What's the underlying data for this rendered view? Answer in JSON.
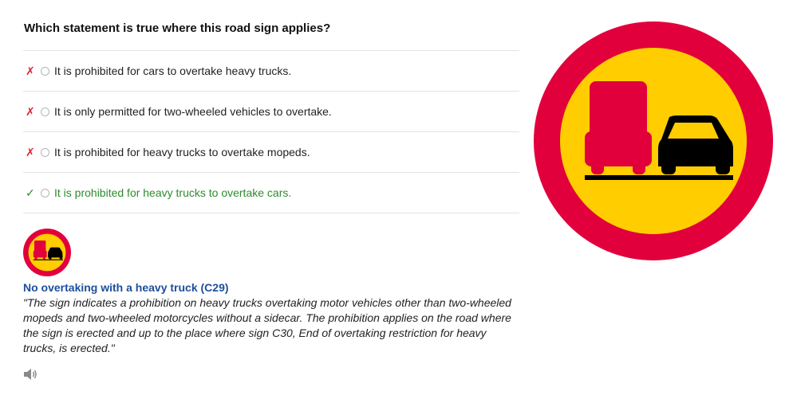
{
  "question": "Which statement is true where this road sign applies?",
  "answers": [
    {
      "mark": "✗",
      "text": "It is prohibited for cars to overtake heavy trucks.",
      "status": "wrong"
    },
    {
      "mark": "✗",
      "text": "It is only permitted for two-wheeled vehicles to overtake.",
      "status": "wrong"
    },
    {
      "mark": "✗",
      "text": "It is prohibited for heavy trucks to overtake mopeds.",
      "status": "wrong"
    },
    {
      "mark": "✓",
      "text": "It is prohibited for heavy trucks to overtake cars.",
      "status": "correct"
    }
  ],
  "sign": {
    "title": "No overtaking with a heavy truck (C29)",
    "description": "\"The sign indicates a prohibition on heavy trucks overtaking motor vehicles other than two-wheeled mopeds and two-wheeled motorcycles without a sidecar. The prohibition applies on the road where the sign is erected and up to the place where sign C30, End of overtaking restriction for heavy trucks, is erected.\""
  },
  "icons": {
    "wrong": "cross-icon",
    "correct": "check-icon",
    "audio": "speaker-icon",
    "sign": "no-overtaking-heavy-truck-sign"
  },
  "colors": {
    "sign_ring": "#e2003c",
    "sign_field": "#ffcd00",
    "truck": "#e2003c",
    "car": "#000000",
    "wrong_mark": "#e0202e",
    "correct_mark": "#2e8b2e",
    "title": "#1c4f9c"
  }
}
